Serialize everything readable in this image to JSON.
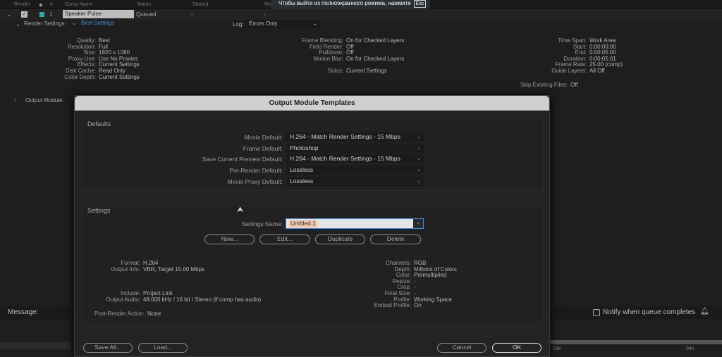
{
  "queue": {
    "headers": [
      "Render",
      "#",
      "Comp Name",
      "Status",
      "Started",
      "Render Time"
    ],
    "row": {
      "number": "1",
      "comp_name": "Speaker Pulse",
      "status": "Queued",
      "started": "-",
      "render_time": "-",
      "label_color": "#2fa8a8"
    },
    "render_settings_label": "Render Settings:",
    "render_settings_value": "Best Settings",
    "log_label": "Log:",
    "log_value": "Errors Only",
    "col1": [
      [
        "Quality:",
        "Best"
      ],
      [
        "Resolution:",
        "Full"
      ],
      [
        "Size:",
        "1920 x 1080"
      ],
      [
        "Proxy Use:",
        "Use No Proxies"
      ],
      [
        "Effects:",
        "Current Settings"
      ],
      [
        "Disk Cache:",
        "Read Only"
      ],
      [
        "Color Depth:",
        "Current Settings"
      ]
    ],
    "col2": [
      [
        "Frame Blending:",
        "On for Checked Layers"
      ],
      [
        "Field Render:",
        "Off"
      ],
      [
        "Pulldown:",
        "Off"
      ],
      [
        "Motion Blur:",
        "On for Checked Layers"
      ]
    ],
    "solos": [
      "Solos:",
      "Current Settings"
    ],
    "col3": [
      [
        "Time Span:",
        "Work Area"
      ],
      [
        "Start:",
        "0:00:00:00"
      ],
      [
        "End:",
        "0:00:05:00"
      ],
      [
        "Duration:",
        "0:00:05:01"
      ],
      [
        "Frame Rate:",
        "25.00 (comp)"
      ],
      [
        "Guide Layers:",
        "All Off"
      ]
    ],
    "skip": [
      "Skip Existing Files:",
      "Off"
    ],
    "output_module_label": "Output Module:"
  },
  "toast": {
    "text": "Чтобы выйти из полноэкранного режима, нажмите",
    "key": "Esc"
  },
  "message_label": "Message:",
  "notify_label": "Notify when queue completes",
  "timeline": {
    "ticks": [
      "03s",
      "04s"
    ]
  },
  "dialog": {
    "title": "Output Module Templates",
    "defaults_heading": "Defaults",
    "defaults": [
      {
        "label": "Movie Default:",
        "value": "H.264 - Match Render Settings - 15 Mbps"
      },
      {
        "label": "Frame Default:",
        "value": "Photoshop"
      },
      {
        "label": "Save Current Preview Default:",
        "value": "H.264 - Match Render Settings - 15 Mbps"
      },
      {
        "label": "Pre-Render Default:",
        "value": "Lossless"
      },
      {
        "label": "Movie Proxy Default:",
        "value": "Lossless"
      }
    ],
    "settings_heading": "Settings",
    "settings_name_label": "Settings Name:",
    "settings_name_value": "Untitled 1",
    "buttons": {
      "new": "New...",
      "edit": "Edit...",
      "duplicate": "Duplicate",
      "delete": "Delete",
      "save_all": "Save All...",
      "load": "Load...",
      "cancel": "Cancel",
      "ok": "OK"
    },
    "info_left": [
      [
        "Format:",
        "H.264"
      ],
      [
        "Output Info:",
        "VBR, Target 15.00 Mbps"
      ],
      [
        "",
        ""
      ],
      [
        "",
        ""
      ],
      [
        "",
        ""
      ],
      [
        "Include:",
        "Project Link"
      ],
      [
        "Output Audio:",
        "48.000 kHz / 16 bit / Stereo (if comp has audio)"
      ]
    ],
    "post_render": [
      "Post-Render Action:",
      "None"
    ],
    "info_right": [
      [
        "Channels:",
        "RGB"
      ],
      [
        "Depth:",
        "Millions of Colors"
      ],
      [
        "Color:",
        "Premultiplied"
      ],
      [
        "Resize:",
        "-"
      ],
      [
        "Crop:",
        "-"
      ],
      [
        "Final Size:",
        "-"
      ],
      [
        "Profile:",
        "Working Space"
      ],
      [
        "Embed Profile:",
        "On"
      ]
    ]
  }
}
